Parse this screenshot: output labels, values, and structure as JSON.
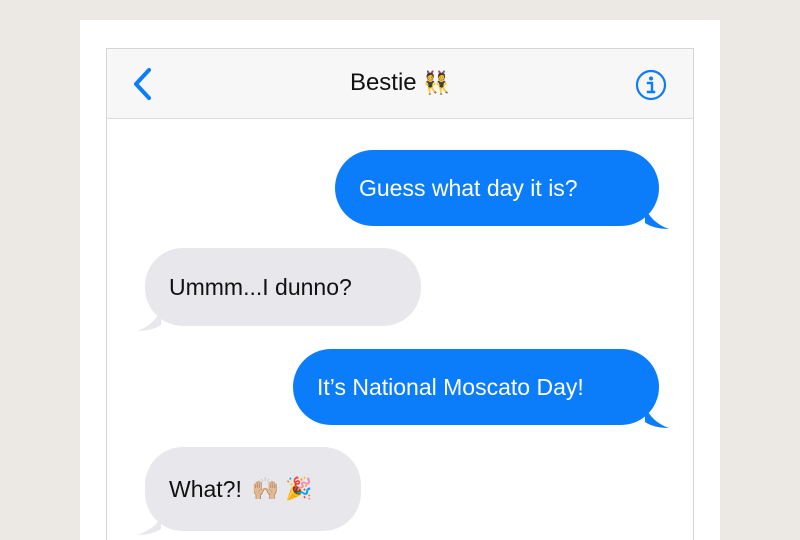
{
  "header": {
    "back_icon": "chevron-left-icon",
    "contact_name": "Bestie",
    "contact_emoji": "👯",
    "info_icon": "info-circle-icon",
    "accent": "#0b7dfb"
  },
  "messages": [
    {
      "direction": "outgoing",
      "text": "Guess what day it is?"
    },
    {
      "direction": "incoming",
      "text": "Ummm...I dunno?"
    },
    {
      "direction": "outgoing",
      "text": "It’s National Moscato Day!"
    },
    {
      "direction": "incoming",
      "text": "What?!",
      "emojis": "🙌🏼 🎉"
    }
  ],
  "colors": {
    "outgoing_bubble": "#0b7dfb",
    "incoming_bubble": "#e8e8ec",
    "background": "#ece8e4"
  }
}
